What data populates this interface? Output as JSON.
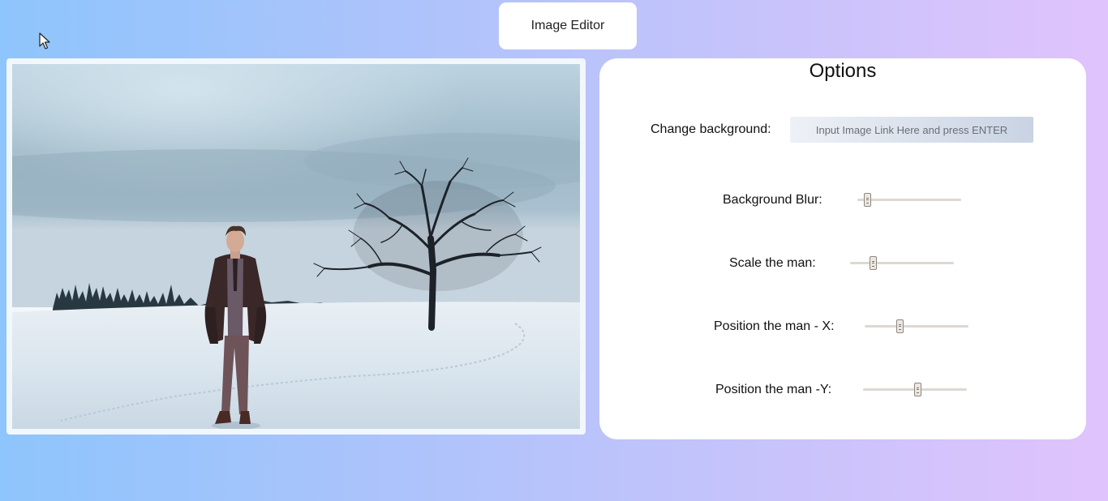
{
  "header": {
    "title": "Image Editor"
  },
  "canvas": {
    "image": "snowy-field-with-man-and-tree"
  },
  "options": {
    "heading": "Options",
    "change_background": {
      "label": "Change background:",
      "placeholder": "Input Image Link Here and press ENTER",
      "value": ""
    },
    "sliders": [
      {
        "id": "blur",
        "label": "Background Blur:",
        "level": 0.1
      },
      {
        "id": "scale",
        "label": "Scale the man:",
        "level": 0.23
      },
      {
        "id": "pos-x",
        "label": "Position the man - X:",
        "level": 0.34
      },
      {
        "id": "pos-y",
        "label": "Position the man -Y:",
        "level": 0.53
      }
    ]
  },
  "colors": {
    "gradient_start": "#8ec5fc",
    "gradient_end": "#e0c3fc",
    "panel": "#ffffff",
    "slider_track": "#ddd8d2"
  },
  "icons": {
    "cursor": "mouse-pointer-icon"
  }
}
